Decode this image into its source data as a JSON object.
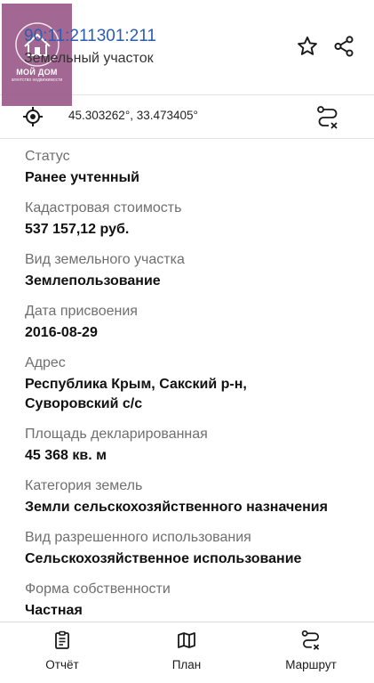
{
  "header": {
    "cadastral_number": "90:11:211301:211",
    "object_type": "Земельный участок",
    "logo_text": "МОЙ ДОМ",
    "logo_subtext": "агентство недвижимости"
  },
  "location": {
    "coordinates": "45.303262°, 33.473405°"
  },
  "fields": [
    {
      "label": "Статус",
      "value": "Ранее учтенный"
    },
    {
      "label": "Кадастровая стоимость",
      "value": "537 157,12 руб."
    },
    {
      "label": "Вид земельного участка",
      "value": "Землепользование"
    },
    {
      "label": "Дата присвоения",
      "value": "2016-08-29"
    },
    {
      "label": "Адрес",
      "value": "Республика Крым, Сакский р-н,",
      "value2": "Суворовский с/с"
    },
    {
      "label": "Площадь декларированная",
      "value": "45 368 кв. м"
    },
    {
      "label": "Категория земель",
      "value": "Земли сельскохозяйственного назначения"
    },
    {
      "label": "Вид разрешенного использования",
      "value": "Сельскохозяйственное использование"
    },
    {
      "label": "Форма собственности",
      "value": "Частная"
    }
  ],
  "bottom_nav": {
    "report": "Отчёт",
    "plan": "План",
    "route": "Маршрут"
  },
  "colors": {
    "accent": "#2a5db0",
    "logo_bg": "#9b5c8a"
  }
}
